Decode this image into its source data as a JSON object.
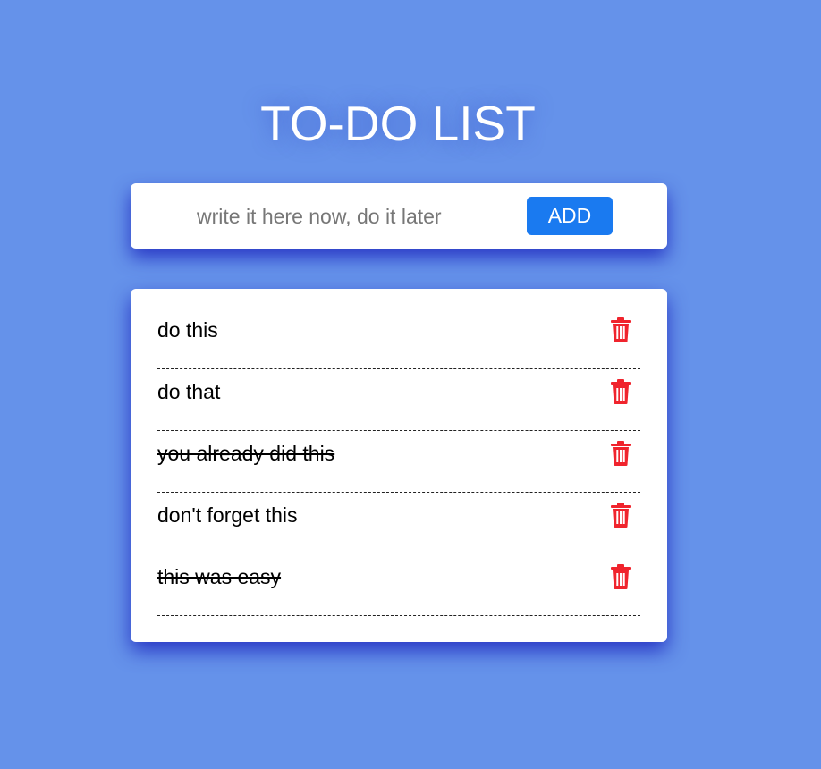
{
  "header": {
    "title": "TO-DO LIST"
  },
  "form": {
    "input_value": "",
    "input_placeholder": "write it here now, do it later",
    "add_label": "ADD"
  },
  "todos": [
    {
      "text": "do this",
      "done": false
    },
    {
      "text": "do that",
      "done": false
    },
    {
      "text": "you already did this",
      "done": true
    },
    {
      "text": "don't forget this",
      "done": false
    },
    {
      "text": "this was easy",
      "done": true
    }
  ],
  "icons": {
    "delete": "trash-icon"
  },
  "colors": {
    "background": "#6592ea",
    "accent": "#1a7af0",
    "delete": "#f0242d",
    "card": "#ffffff"
  }
}
